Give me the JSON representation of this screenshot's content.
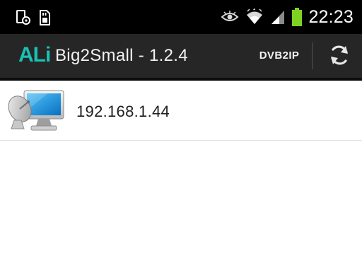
{
  "status_bar": {
    "time": "22:23",
    "icons": [
      "screenshot-icon",
      "sd-card-icon",
      "eye-icon",
      "wifi-icon",
      "signal-icon",
      "battery-icon"
    ],
    "battery_color": "#7ed321"
  },
  "action_bar": {
    "logo_text": "ALi",
    "title": "Big2Small - 1.2.4",
    "action_label": "DVB2IP",
    "refresh_icon": "refresh-icon",
    "logo_color": "#19c1b3",
    "background": "#262626"
  },
  "devices": [
    {
      "ip": "192.168.1.44",
      "icon": "satellite-computer-icon"
    }
  ]
}
